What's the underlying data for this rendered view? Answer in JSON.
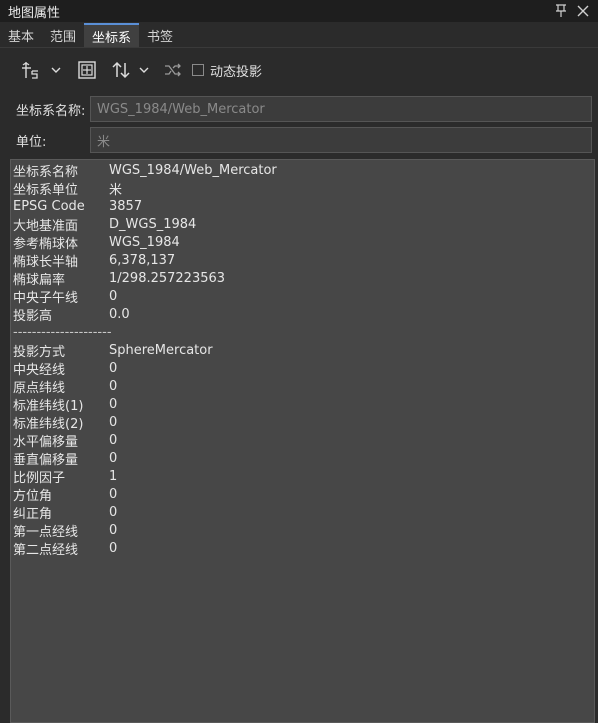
{
  "window": {
    "title": "地图属性"
  },
  "tabs": [
    {
      "label": "基本"
    },
    {
      "label": "范围"
    },
    {
      "label": "坐标系"
    },
    {
      "label": "书签"
    }
  ],
  "toolbar": {
    "dynamic_projection_label": "动态投影",
    "dynamic_projection_checked": false
  },
  "fields": {
    "crs_name_label": "坐标系名称:",
    "crs_name_value": "WGS_1984/Web_Mercator",
    "unit_label": "单位:",
    "unit_value": "米"
  },
  "info_rows_top": [
    {
      "key": "坐标系名称",
      "value": "WGS_1984/Web_Mercator"
    },
    {
      "key": "坐标系单位",
      "value": "米"
    },
    {
      "key": "EPSG Code",
      "value": "3857"
    },
    {
      "key": "大地基准面",
      "value": "D_WGS_1984"
    },
    {
      "key": "参考椭球体",
      "value": "WGS_1984"
    },
    {
      "key": "椭球长半轴",
      "value": "6,378,137"
    },
    {
      "key": "椭球扁率",
      "value": "1/298.257223563"
    },
    {
      "key": "中央子午线",
      "value": "0"
    },
    {
      "key": "投影高",
      "value": "0.0"
    }
  ],
  "divider_text": "---------------------",
  "info_rows_bottom": [
    {
      "key": "投影方式",
      "value": "SphereMercator"
    },
    {
      "key": "中央经线",
      "value": "0"
    },
    {
      "key": "原点纬线",
      "value": "0"
    },
    {
      "key": "标准纬线(1)",
      "value": "0"
    },
    {
      "key": "标准纬线(2)",
      "value": "0"
    },
    {
      "key": "水平偏移量",
      "value": "0"
    },
    {
      "key": "垂直偏移量",
      "value": "0"
    },
    {
      "key": "比例因子",
      "value": "1"
    },
    {
      "key": "方位角",
      "value": "0"
    },
    {
      "key": "纠正角",
      "value": "0"
    },
    {
      "key": "第一点经线",
      "value": "0"
    },
    {
      "key": "第二点经线",
      "value": "0"
    }
  ],
  "colors": {
    "background": "#2b2b2b",
    "panel": "#474747",
    "tab_active": "#404040",
    "titlebar": "#1e1e1e"
  }
}
